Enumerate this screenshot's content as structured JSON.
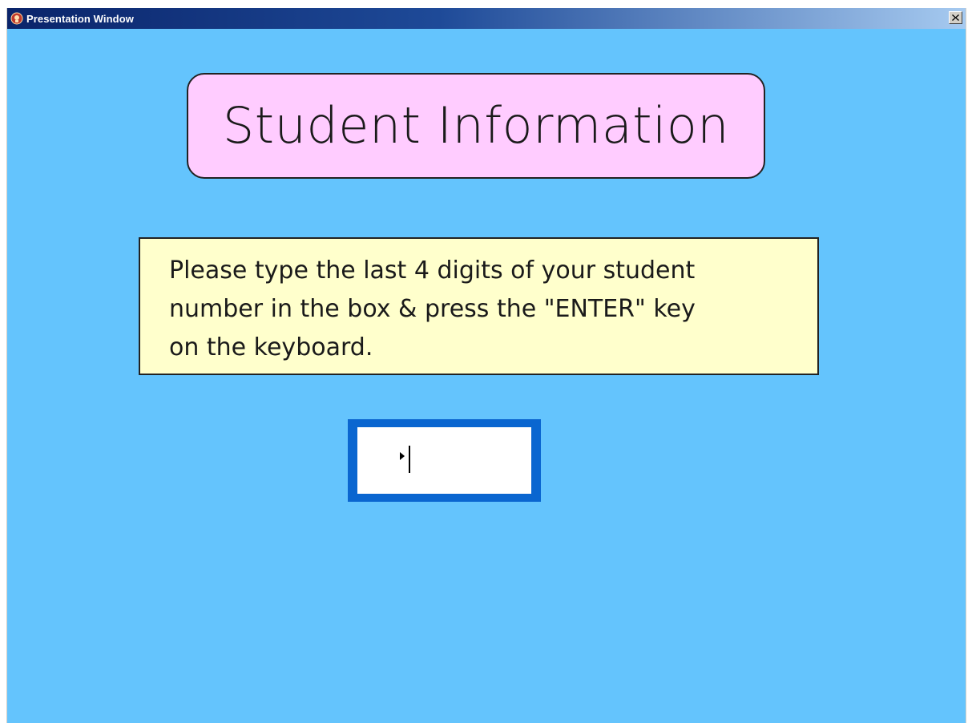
{
  "window": {
    "title": "Presentation Window",
    "close_label": "×"
  },
  "content": {
    "heading": "Student Information",
    "instruction": "Please type the last 4 digits of your student\nnumber in the box & press the \"ENTER\" key\non the keyboard.",
    "input": {
      "value": "",
      "placeholder": ""
    }
  },
  "colors": {
    "background": "#64c4fd",
    "heading_box": "#ffccff",
    "instruction_box": "#ffffcc",
    "input_frame": "#0a66d0"
  },
  "icons": {
    "app": "presentation-app-icon",
    "close": "close-icon",
    "caret": "play-caret-icon"
  }
}
